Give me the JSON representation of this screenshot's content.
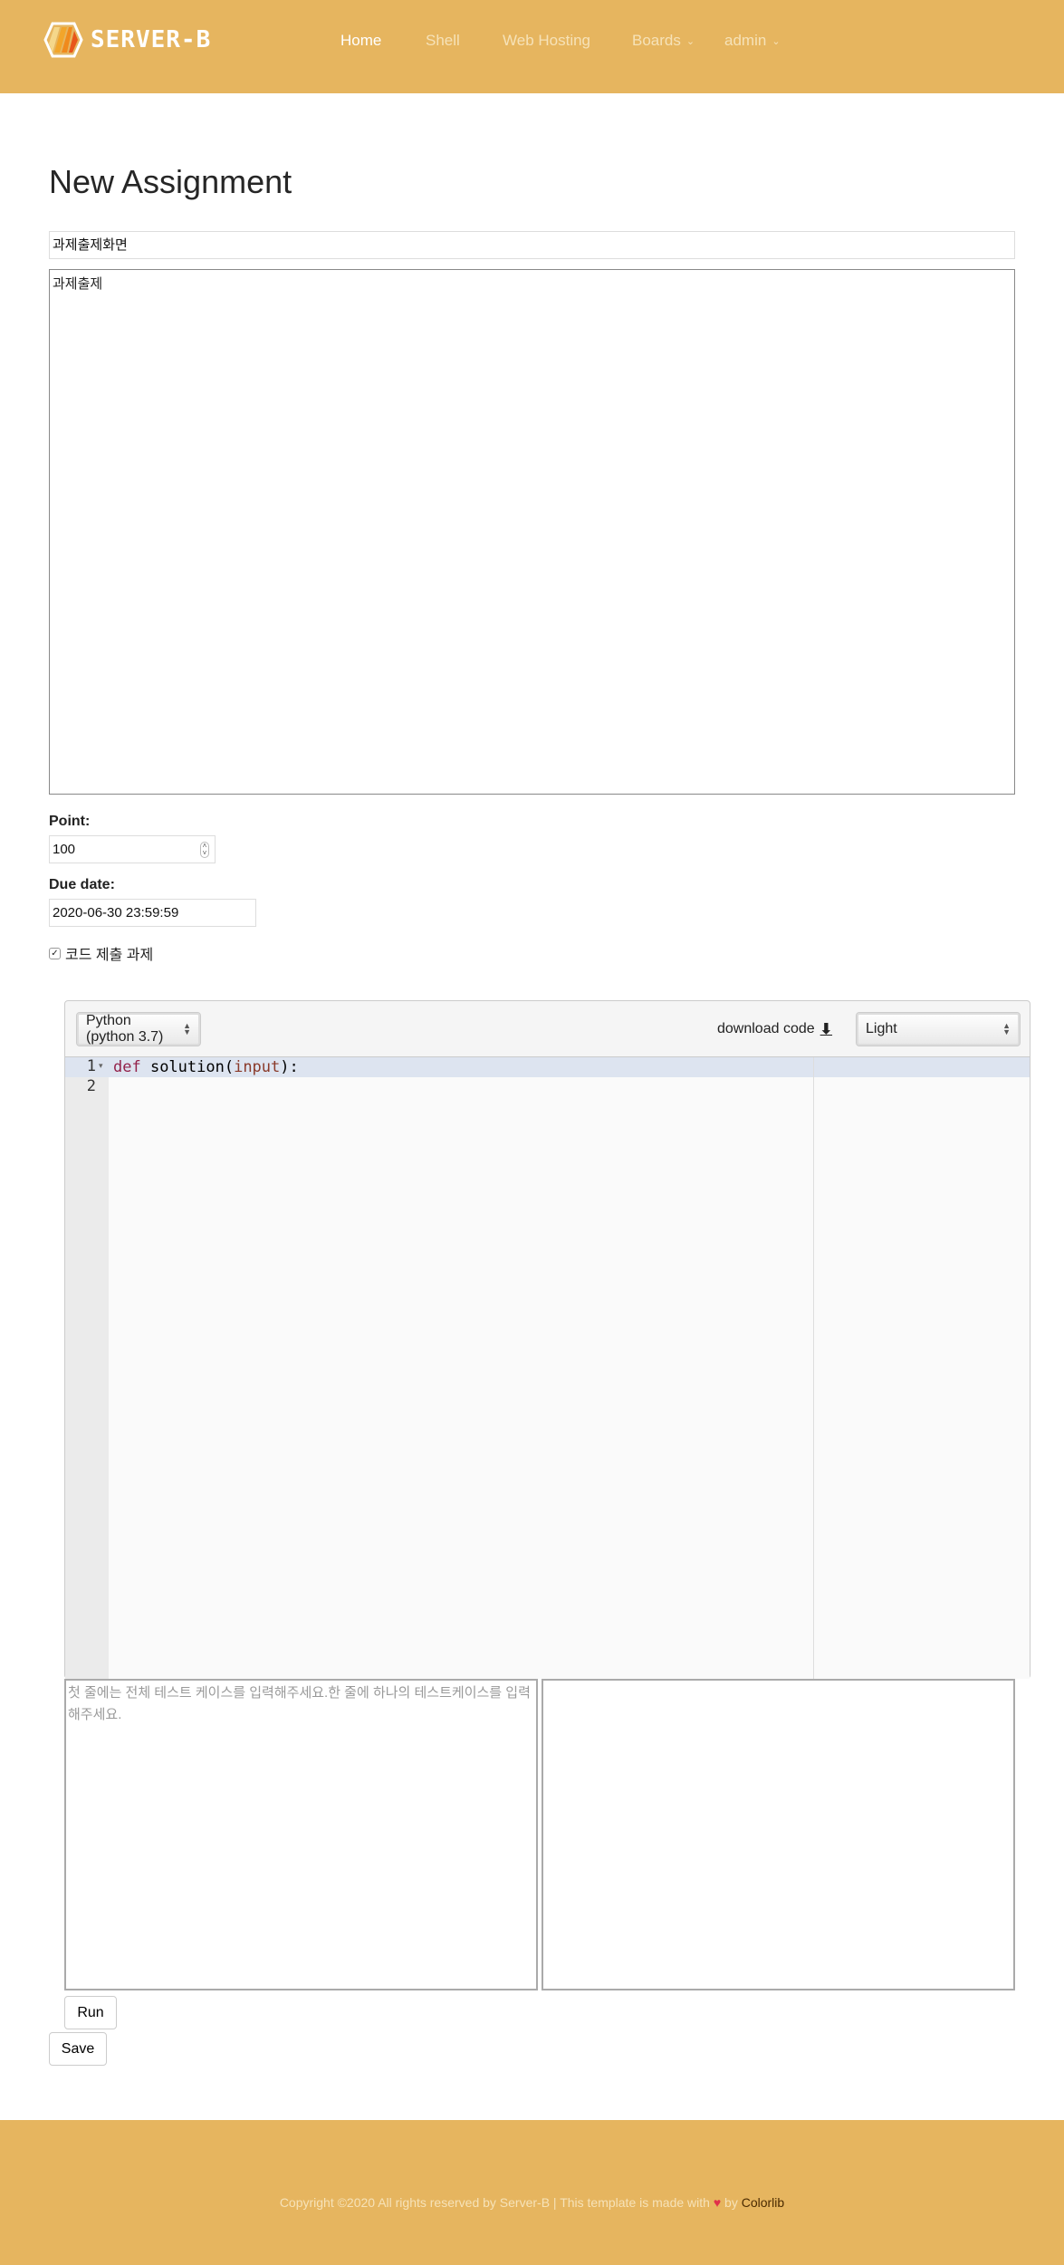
{
  "brand": {
    "name": "SERVER-B",
    "accent": "#e6b55f"
  },
  "nav": [
    {
      "label": "Home",
      "active": true
    },
    {
      "label": "Shell"
    },
    {
      "label": "Web Hosting"
    },
    {
      "label": "Boards",
      "dropdown": true
    },
    {
      "label": "admin",
      "dropdown": true
    }
  ],
  "page": {
    "title": "New Assignment"
  },
  "form": {
    "title_value": "과제출제화면",
    "description_value": "과제출제",
    "point_label": "Point:",
    "point_value": "100",
    "due_label": "Due date:",
    "due_value": "2020-06-30 23:59:59",
    "code_checkbox_label": "코드 제출 과제",
    "code_checkbox_checked": true
  },
  "editor": {
    "language": "Python (python 3.7)",
    "download_label": "download code",
    "theme": "Light",
    "line_numbers": [
      "1",
      "2"
    ],
    "code": {
      "kw": "def",
      "name": " solution(",
      "arg": "input",
      "end": "):"
    }
  },
  "testcases": {
    "input_placeholder": "첫 줄에는 전체 테스트 케이스를 입력해주세요.한 줄에 하나의 테스트케이스를 입력해주세요."
  },
  "buttons": {
    "run": "Run",
    "save": "Save"
  },
  "footer": {
    "text": "Copyright ©2020 All rights reserved by Server-B | This template is made with",
    "heart": "♥",
    "by": " by ",
    "link": "Colorlib"
  }
}
